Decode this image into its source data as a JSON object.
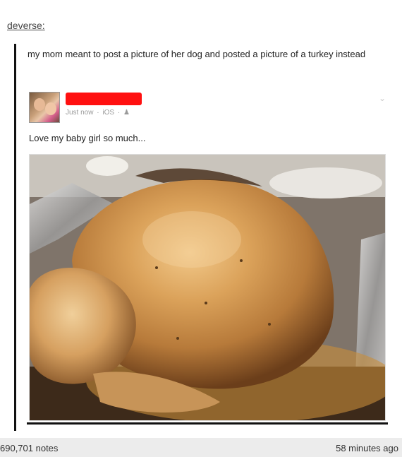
{
  "post": {
    "username": "deverse:",
    "text": "my mom meant to post a picture of her dog and posted a picture of a turkey instead"
  },
  "facebook": {
    "timestamp": "Just now",
    "platform": "iOS",
    "separator": "·",
    "audience_icon": "friends-icon",
    "caption": "Love my baby girl so much..."
  },
  "footer": {
    "notes": "690,701 notes",
    "time": "58 minutes ago"
  },
  "colors": {
    "redaction": "#ff1010",
    "footer_bg": "#ececec",
    "quote_bar": "#111111"
  }
}
